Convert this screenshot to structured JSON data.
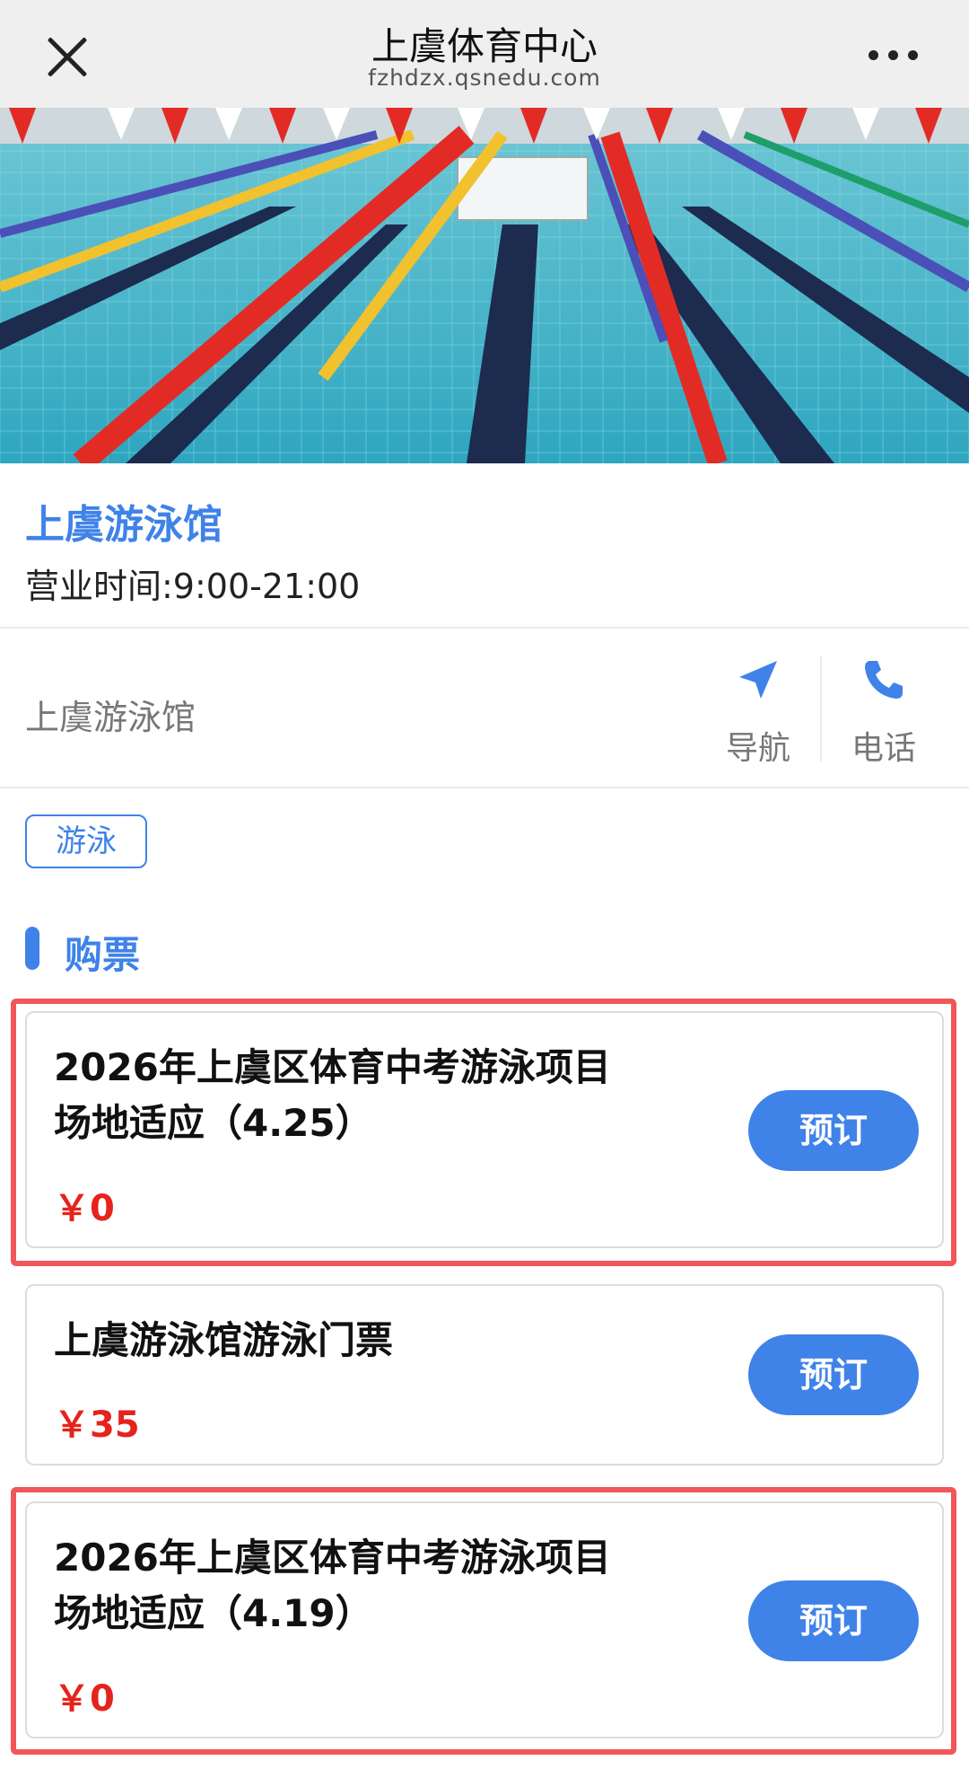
{
  "topbar": {
    "title": "上虞体育中心",
    "url": "fzhdzx.qsnedu.com",
    "close_icon": "close-icon",
    "more_icon": "more-icon"
  },
  "hero": {
    "image": "swimming-pool-photo",
    "active_slide_indicator": "carousel-dot"
  },
  "venue": {
    "name": "上虞游泳馆",
    "hours": "营业时间:9:00-21:00",
    "address": "上虞游泳馆",
    "nav_label": "导航",
    "phone_label": "电话"
  },
  "tags": [
    "游泳"
  ],
  "section": {
    "title": "购票"
  },
  "tickets": [
    {
      "title_line1": "2026年上虞区体育中考游泳项目",
      "title_line2": "场地适应（4.25）",
      "price": "￥0",
      "button": "预订",
      "highlighted": true
    },
    {
      "title_line1": "上虞游泳馆游泳门票",
      "title_line2": "",
      "price": "￥35",
      "button": "预订",
      "highlighted": false
    },
    {
      "title_line1": "2026年上虞区体育中考游泳项目",
      "title_line2": "场地适应（4.19）",
      "price": "￥0",
      "button": "预订",
      "highlighted": true
    }
  ],
  "colors": {
    "accent": "#3f82e8",
    "price": "#e5231c",
    "highlight_border": "#f1575a"
  }
}
